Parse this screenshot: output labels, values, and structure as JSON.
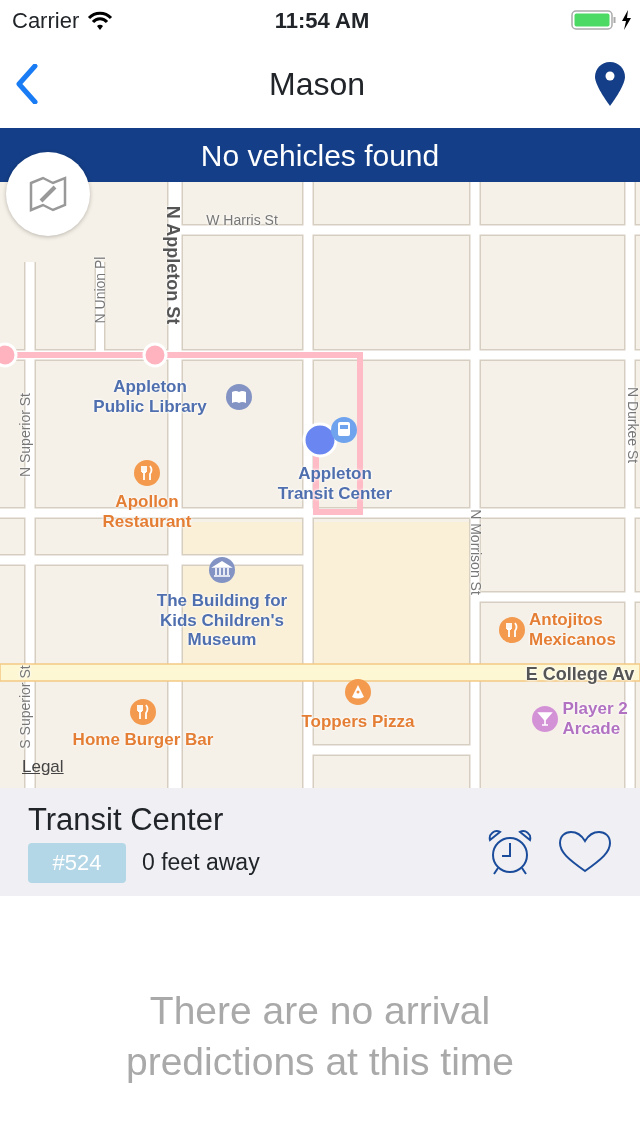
{
  "status_bar": {
    "carrier": "Carrier",
    "time": "11:54 AM",
    "charging": true
  },
  "nav": {
    "title": "Mason"
  },
  "banner": {
    "text": "No vehicles found"
  },
  "map": {
    "labels": [
      {
        "text": "W Harris St",
        "kind": "street"
      },
      {
        "text": "N Appleton St",
        "kind": "street-major"
      },
      {
        "text": "N Union Pl",
        "kind": "street"
      },
      {
        "text": "N Superior St",
        "kind": "street"
      },
      {
        "text": "Appleton Public Library",
        "kind": "civic"
      },
      {
        "text": "Appleton Transit Center",
        "kind": "civic"
      },
      {
        "text": "Apollon Restaurant",
        "kind": "food"
      },
      {
        "text": "N Durkee St",
        "kind": "street"
      },
      {
        "text": "The Building for Kids Children's Museum",
        "kind": "civic"
      },
      {
        "text": "N Morrison St",
        "kind": "street"
      },
      {
        "text": "Antojitos Mexicanos",
        "kind": "food"
      },
      {
        "text": "E College Av",
        "kind": "street-major"
      },
      {
        "text": "Toppers Pizza",
        "kind": "food"
      },
      {
        "text": "Player 2 Arcade",
        "kind": "leisure"
      },
      {
        "text": "Home Burger Bar",
        "kind": "food"
      },
      {
        "text": "S Superior St",
        "kind": "street"
      }
    ],
    "legal": "Legal"
  },
  "stop": {
    "name": "Transit Center",
    "number": "#524",
    "distance": "0 feet away",
    "favorite": false
  },
  "message": "There are no arrival predictions at this time"
}
